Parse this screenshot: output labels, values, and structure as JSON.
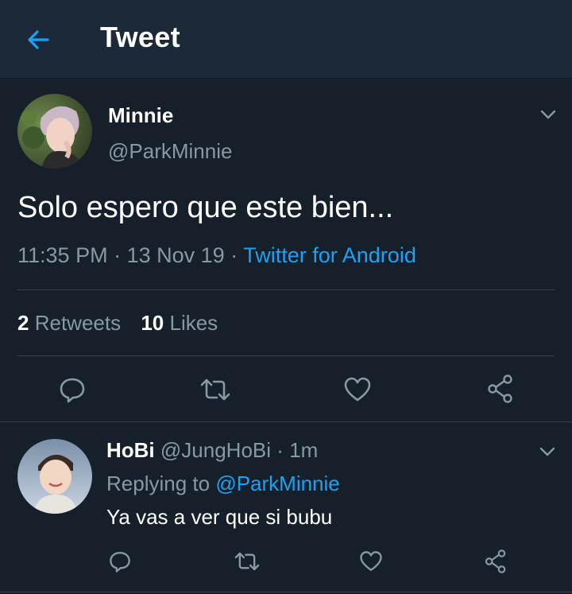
{
  "header": {
    "title": "Tweet",
    "back_icon": "arrow-left-icon"
  },
  "tweet": {
    "display_name": "Minnie",
    "handle": "@ParkMinnie",
    "text": "Solo espero que este bien...",
    "time": "11:35 PM",
    "sep1": "·",
    "date": "13 Nov 19",
    "sep2": "·",
    "source": "Twitter for Android",
    "retweets_count": "2",
    "retweets_label": "Retweets",
    "likes_count": "10",
    "likes_label": "Likes"
  },
  "reply": {
    "display_name": "HoBi",
    "handle": "@JungHoBi",
    "sep": "·",
    "age": "1m",
    "replying_prefix": "Replying to",
    "replying_to": "@ParkMinnie",
    "text": "Ya vas a ver que si bubu"
  },
  "colors": {
    "background": "#15202b",
    "header": "#1c2938",
    "accent": "#1da1f2",
    "muted": "#8899a6",
    "divider": "#38444d"
  },
  "icons": [
    "arrow-left-icon",
    "chevron-down-icon",
    "reply-icon",
    "retweet-icon",
    "heart-icon",
    "share-icon"
  ]
}
